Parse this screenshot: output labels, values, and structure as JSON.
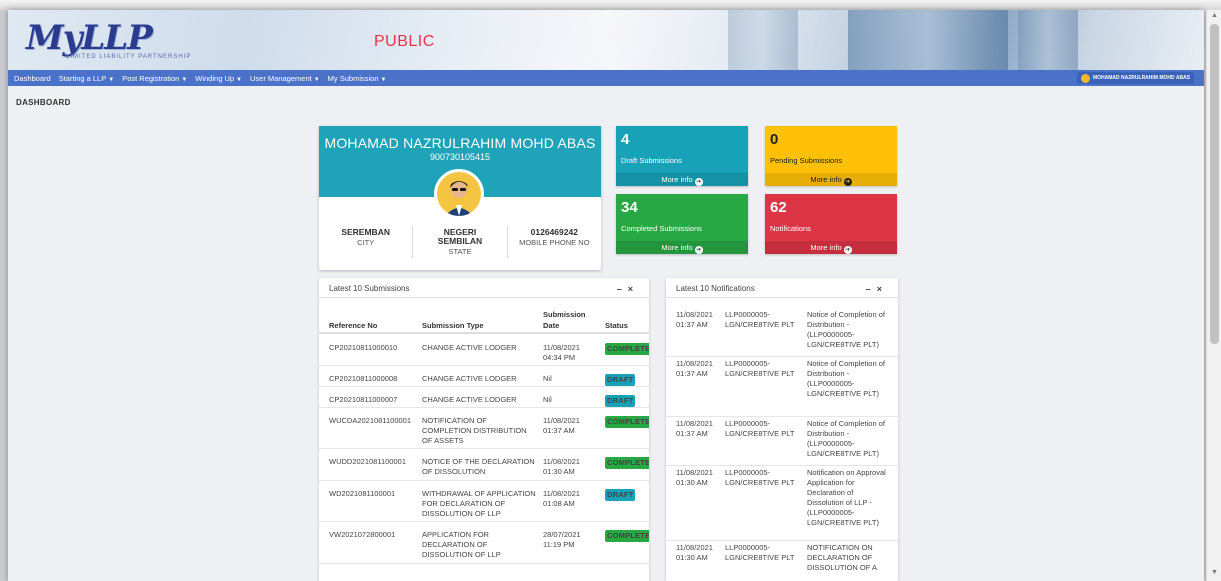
{
  "header": {
    "logo_text": "MyLLP",
    "logo_sub": "LIMITED LIABILITY PARTNERSHIP",
    "portal": "PUBLIC"
  },
  "nav": {
    "items": [
      {
        "label": "Dashboard",
        "caret": false
      },
      {
        "label": "Starting a LLP",
        "caret": true
      },
      {
        "label": "Post Registration",
        "caret": true
      },
      {
        "label": "Winding Up",
        "caret": true
      },
      {
        "label": "User Management",
        "caret": true
      },
      {
        "label": "My Submission",
        "caret": true
      }
    ],
    "user": "MOHAMAD NAZRULRAHIM MOHD ABAS"
  },
  "page_title": "DASHBOARD",
  "profile": {
    "name": "MOHAMAD NAZRULRAHIM MOHD ABAS",
    "id_no": "900730105415",
    "city_value": "SEREMBAN",
    "city_label": "CITY",
    "state_value_1": "NEGERI",
    "state_value_2": "SEMBILAN",
    "state_label": "STATE",
    "phone_value": "0126469242",
    "phone_label": "MOBILE PHONE NO"
  },
  "stats": {
    "draft": {
      "count": "4",
      "label": "Draft Submissions",
      "more": "More info",
      "color": "#17a2b8"
    },
    "pending": {
      "count": "0",
      "label": "Pending Submissions",
      "more": "More info",
      "color": "#ffc107"
    },
    "completed": {
      "count": "34",
      "label": "Completed Submissions",
      "more": "More info",
      "color": "#28a745"
    },
    "notifications": {
      "count": "62",
      "label": "Notifications",
      "more": "More info",
      "color": "#dc3545"
    }
  },
  "submissions": {
    "title": "Latest 10 Submissions",
    "tools": "– ×",
    "columns": {
      "ref": "Reference No",
      "type": "Submission Type",
      "date_1": "Submission",
      "date_2": "Date",
      "status": "Status"
    },
    "rows": [
      {
        "ref": "CP20210811000010",
        "type": [
          "CHANGE ACTIVE LODGER"
        ],
        "date": [
          "11/08/2021",
          "04:34 PM"
        ],
        "status": "COMPLETE",
        "kind": "complete"
      },
      {
        "ref": "CP20210811000008",
        "type": [
          "CHANGE ACTIVE LODGER"
        ],
        "date": [
          "Nil"
        ],
        "status": "DRAFT",
        "kind": "draft"
      },
      {
        "ref": "CP20210811000007",
        "type": [
          "CHANGE ACTIVE LODGER"
        ],
        "date": [
          "Nil"
        ],
        "status": "DRAFT",
        "kind": "draft"
      },
      {
        "ref": "WUCDA2021081100001",
        "type": [
          "NOTIFICATION OF",
          "COMPLETION DISTRIBUTION",
          "OF ASSETS"
        ],
        "date": [
          "11/08/2021",
          "01:37 AM"
        ],
        "status": "COMPLETE",
        "kind": "complete"
      },
      {
        "ref": "WUDD2021081100001",
        "type": [
          "NOTICE OF THE DECLARATION",
          "OF DISSOLUTION"
        ],
        "date": [
          "11/08/2021",
          "01:30 AM"
        ],
        "status": "COMPLETE",
        "kind": "complete"
      },
      {
        "ref": "WD2021081100001",
        "type": [
          "WITHDRAWAL OF APPLICATION",
          "FOR DECLARATION OF",
          "DISSOLUTION OF LLP"
        ],
        "date": [
          "11/08/2021",
          "01:08 AM"
        ],
        "status": "DRAFT",
        "kind": "draft"
      },
      {
        "ref": "VW2021072800001",
        "type": [
          "APPLICATION FOR",
          "DECLARATION OF",
          "DISSOLUTION OF LLP"
        ],
        "date": [
          "28/07/2021",
          "11:19 PM"
        ],
        "status": "COMPLETE",
        "kind": "complete"
      }
    ]
  },
  "notifications": {
    "title": "Latest 10 Notifications",
    "tools": "– ×",
    "rows": [
      {
        "date": [
          "11/08/2021",
          "01:37 AM"
        ],
        "ref": [
          "LLP0000005-",
          "LGN/CRE8TIVE PLT"
        ],
        "msg": [
          "Notice of Completion of",
          "Distribution -",
          "(LLP0000005-",
          "LGN/CRE8TIVE PLT)"
        ]
      },
      {
        "date": [
          "11/08/2021",
          "01:37 AM"
        ],
        "ref": [
          "LLP0000005-",
          "LGN/CRE8TIVE PLT"
        ],
        "msg": [
          "Notice of Completion of",
          "Distribution -",
          "(LLP0000005-",
          "LGN/CRE8TIVE PLT)"
        ]
      },
      {
        "date": [
          "11/08/2021",
          "01:37 AM"
        ],
        "ref": [
          "LLP0000005-",
          "LGN/CRE8TIVE PLT"
        ],
        "msg": [
          "Notice of Completion of",
          "Distribution -",
          "(LLP0000005-",
          "LGN/CRE8TIVE PLT)"
        ]
      },
      {
        "date": [
          "11/08/2021",
          "01:30 AM"
        ],
        "ref": [
          "LLP0000005-",
          "LGN/CRE8TIVE PLT"
        ],
        "msg": [
          "Notification on Approval",
          "Application for",
          "Declaration of",
          "Dissolution of LLP -",
          "(LLP0000005-",
          "LGN/CRE8TIVE PLT)"
        ]
      },
      {
        "date": [
          "11/08/2021",
          "01:30 AM"
        ],
        "ref": [
          "LLP0000005-",
          "LGN/CRE8TIVE PLT"
        ],
        "msg": [
          "NOTIFICATION ON",
          "DECLARATION OF",
          "DISSOLUTION OF A"
        ]
      }
    ]
  }
}
